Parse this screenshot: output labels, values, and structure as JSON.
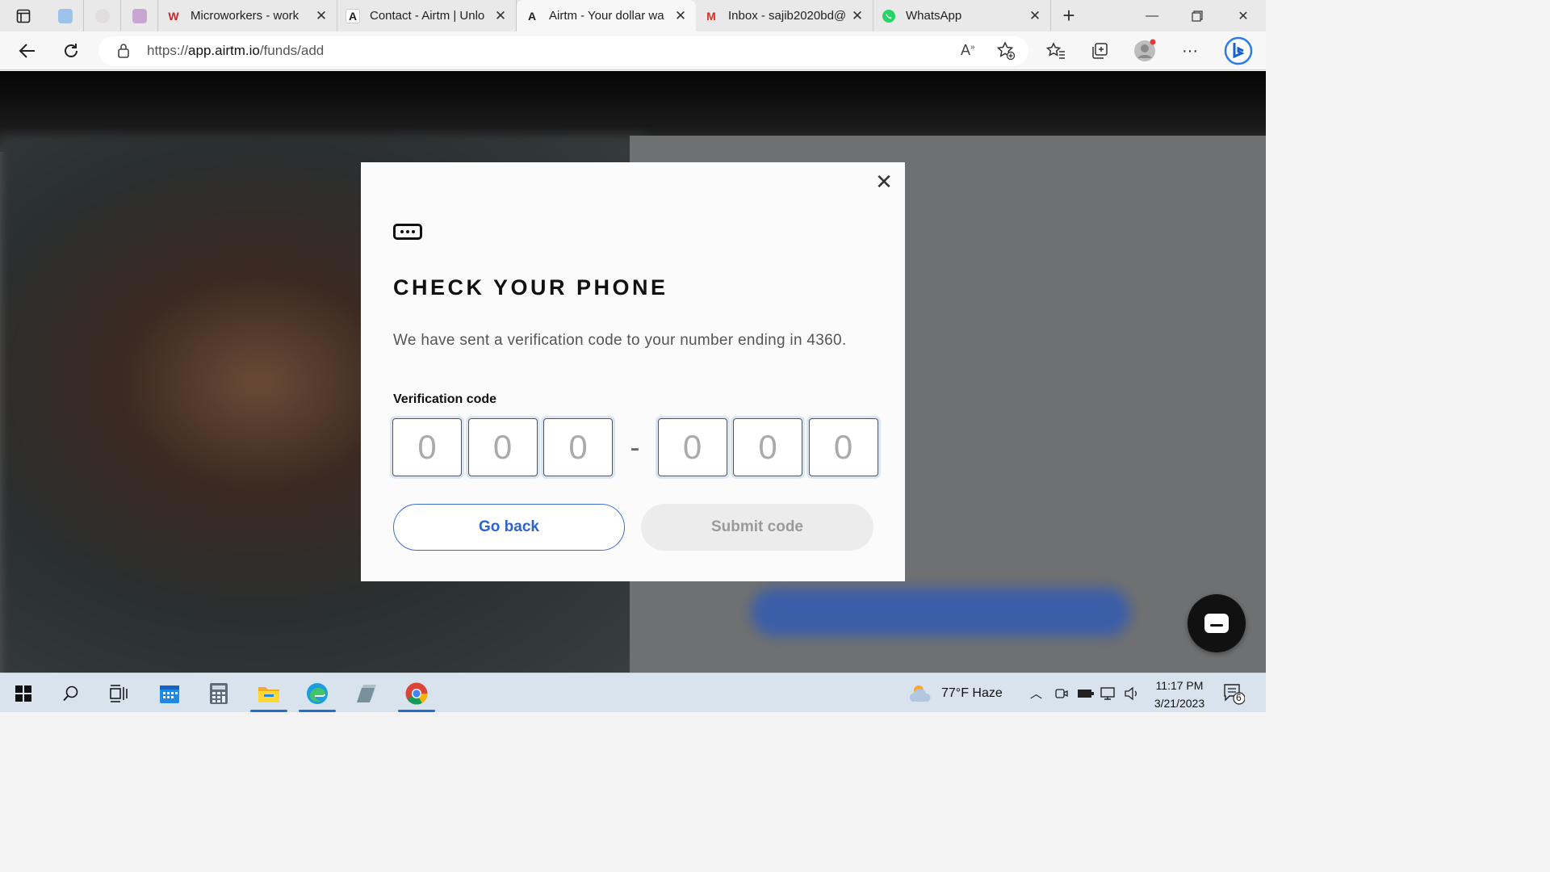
{
  "browser": {
    "tabs": [
      {
        "title": "Microworkers - work",
        "favicon": "W"
      },
      {
        "title": "Contact - Airtm | Unlo",
        "favicon": "A"
      },
      {
        "title": "Airtm - Your dollar wa",
        "favicon": "A",
        "active": true
      },
      {
        "title": "Inbox - sajib2020bd@",
        "favicon": "M"
      },
      {
        "title": "WhatsApp",
        "favicon": "whatsapp-icon"
      }
    ],
    "url_prefix": "https://",
    "url_host": "app.airtm.io",
    "url_path": "/funds/add"
  },
  "modal": {
    "title": "CHECK YOUR PHONE",
    "description": "We have sent a verification code to your number ending in 4360.",
    "code_label": "Verification code",
    "digit_placeholder": "0",
    "separator": "-",
    "back_label": "Go back",
    "submit_label": "Submit code"
  },
  "taskbar": {
    "weather": "77°F  Haze",
    "time": "11:17 PM",
    "date": "3/21/2023",
    "notifications": "6"
  },
  "colors": {
    "accent": "#2f63cc",
    "disabled_bg": "#ececec"
  }
}
